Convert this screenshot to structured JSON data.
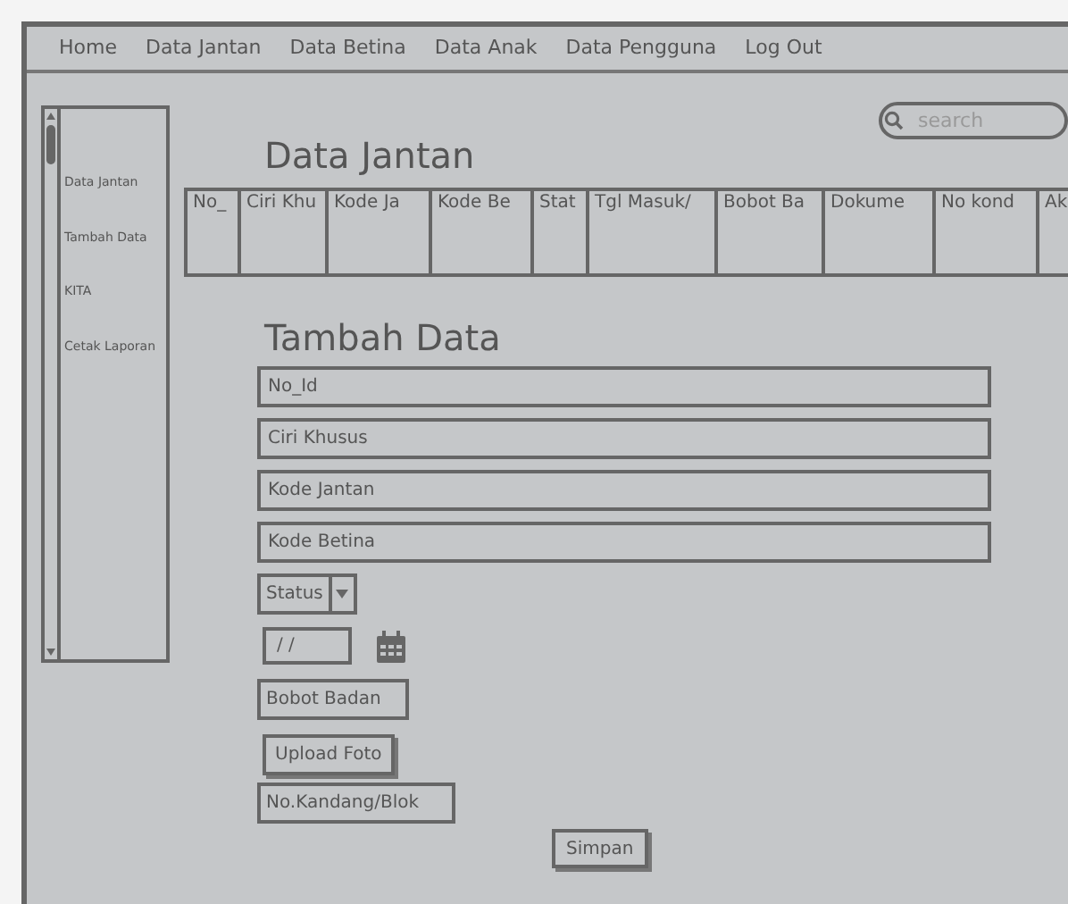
{
  "nav": [
    {
      "label": "Home"
    },
    {
      "label": "Data Jantan"
    },
    {
      "label": "Data Betina"
    },
    {
      "label": "Data Anak"
    },
    {
      "label": "Data Pengguna"
    },
    {
      "label": "Log Out"
    }
  ],
  "sidebar": {
    "items": [
      {
        "label": "Data Jantan"
      },
      {
        "label": "Tambah Data"
      },
      {
        "label": "KITA"
      },
      {
        "label": "Cetak Laporan"
      }
    ]
  },
  "search": {
    "placeholder": "search"
  },
  "page_title": "Data Jantan",
  "table": {
    "columns": [
      "No_",
      "Ciri Khu",
      "Kode Ja",
      "Kode Be",
      "Stat",
      "Tgl Masuk/",
      "Bobot Ba",
      "Dokume",
      "No kond",
      "Ak"
    ]
  },
  "form": {
    "title": "Tambah Data",
    "items": [
      {
        "kind": "field",
        "value": "No_Id"
      },
      {
        "kind": "field",
        "value": "Ciri Khusus"
      },
      {
        "kind": "field",
        "value": "Kode Jantan"
      },
      {
        "kind": "field",
        "value": "Kode Betina"
      },
      {
        "kind": "select",
        "value": "Status"
      },
      {
        "kind": "date",
        "value": "/ /"
      },
      {
        "kind": "box",
        "value": "Bobot Badan"
      },
      {
        "kind": "button",
        "label": "Upload Foto"
      },
      {
        "kind": "box",
        "value": "No.Kandang/Blok"
      }
    ],
    "submit": "Simpan"
  }
}
